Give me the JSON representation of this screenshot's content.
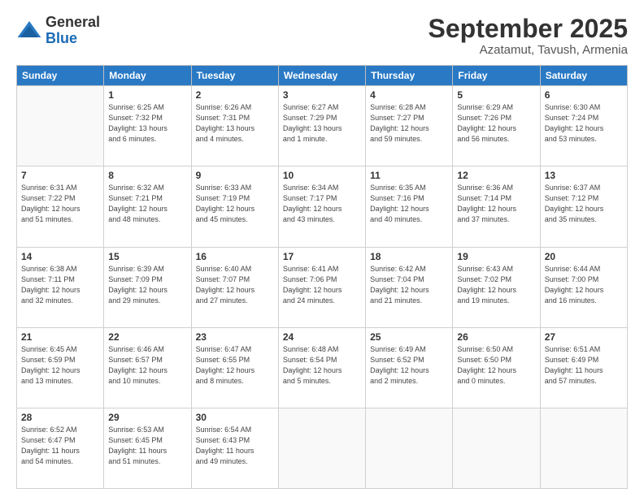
{
  "logo": {
    "general": "General",
    "blue": "Blue"
  },
  "header": {
    "title": "September 2025",
    "subtitle": "Azatamut, Tavush, Armenia"
  },
  "weekdays": [
    "Sunday",
    "Monday",
    "Tuesday",
    "Wednesday",
    "Thursday",
    "Friday",
    "Saturday"
  ],
  "weeks": [
    [
      {
        "day": "",
        "info": ""
      },
      {
        "day": "1",
        "info": "Sunrise: 6:25 AM\nSunset: 7:32 PM\nDaylight: 13 hours\nand 6 minutes."
      },
      {
        "day": "2",
        "info": "Sunrise: 6:26 AM\nSunset: 7:31 PM\nDaylight: 13 hours\nand 4 minutes."
      },
      {
        "day": "3",
        "info": "Sunrise: 6:27 AM\nSunset: 7:29 PM\nDaylight: 13 hours\nand 1 minute."
      },
      {
        "day": "4",
        "info": "Sunrise: 6:28 AM\nSunset: 7:27 PM\nDaylight: 12 hours\nand 59 minutes."
      },
      {
        "day": "5",
        "info": "Sunrise: 6:29 AM\nSunset: 7:26 PM\nDaylight: 12 hours\nand 56 minutes."
      },
      {
        "day": "6",
        "info": "Sunrise: 6:30 AM\nSunset: 7:24 PM\nDaylight: 12 hours\nand 53 minutes."
      }
    ],
    [
      {
        "day": "7",
        "info": "Sunrise: 6:31 AM\nSunset: 7:22 PM\nDaylight: 12 hours\nand 51 minutes."
      },
      {
        "day": "8",
        "info": "Sunrise: 6:32 AM\nSunset: 7:21 PM\nDaylight: 12 hours\nand 48 minutes."
      },
      {
        "day": "9",
        "info": "Sunrise: 6:33 AM\nSunset: 7:19 PM\nDaylight: 12 hours\nand 45 minutes."
      },
      {
        "day": "10",
        "info": "Sunrise: 6:34 AM\nSunset: 7:17 PM\nDaylight: 12 hours\nand 43 minutes."
      },
      {
        "day": "11",
        "info": "Sunrise: 6:35 AM\nSunset: 7:16 PM\nDaylight: 12 hours\nand 40 minutes."
      },
      {
        "day": "12",
        "info": "Sunrise: 6:36 AM\nSunset: 7:14 PM\nDaylight: 12 hours\nand 37 minutes."
      },
      {
        "day": "13",
        "info": "Sunrise: 6:37 AM\nSunset: 7:12 PM\nDaylight: 12 hours\nand 35 minutes."
      }
    ],
    [
      {
        "day": "14",
        "info": "Sunrise: 6:38 AM\nSunset: 7:11 PM\nDaylight: 12 hours\nand 32 minutes."
      },
      {
        "day": "15",
        "info": "Sunrise: 6:39 AM\nSunset: 7:09 PM\nDaylight: 12 hours\nand 29 minutes."
      },
      {
        "day": "16",
        "info": "Sunrise: 6:40 AM\nSunset: 7:07 PM\nDaylight: 12 hours\nand 27 minutes."
      },
      {
        "day": "17",
        "info": "Sunrise: 6:41 AM\nSunset: 7:06 PM\nDaylight: 12 hours\nand 24 minutes."
      },
      {
        "day": "18",
        "info": "Sunrise: 6:42 AM\nSunset: 7:04 PM\nDaylight: 12 hours\nand 21 minutes."
      },
      {
        "day": "19",
        "info": "Sunrise: 6:43 AM\nSunset: 7:02 PM\nDaylight: 12 hours\nand 19 minutes."
      },
      {
        "day": "20",
        "info": "Sunrise: 6:44 AM\nSunset: 7:00 PM\nDaylight: 12 hours\nand 16 minutes."
      }
    ],
    [
      {
        "day": "21",
        "info": "Sunrise: 6:45 AM\nSunset: 6:59 PM\nDaylight: 12 hours\nand 13 minutes."
      },
      {
        "day": "22",
        "info": "Sunrise: 6:46 AM\nSunset: 6:57 PM\nDaylight: 12 hours\nand 10 minutes."
      },
      {
        "day": "23",
        "info": "Sunrise: 6:47 AM\nSunset: 6:55 PM\nDaylight: 12 hours\nand 8 minutes."
      },
      {
        "day": "24",
        "info": "Sunrise: 6:48 AM\nSunset: 6:54 PM\nDaylight: 12 hours\nand 5 minutes."
      },
      {
        "day": "25",
        "info": "Sunrise: 6:49 AM\nSunset: 6:52 PM\nDaylight: 12 hours\nand 2 minutes."
      },
      {
        "day": "26",
        "info": "Sunrise: 6:50 AM\nSunset: 6:50 PM\nDaylight: 12 hours\nand 0 minutes."
      },
      {
        "day": "27",
        "info": "Sunrise: 6:51 AM\nSunset: 6:49 PM\nDaylight: 11 hours\nand 57 minutes."
      }
    ],
    [
      {
        "day": "28",
        "info": "Sunrise: 6:52 AM\nSunset: 6:47 PM\nDaylight: 11 hours\nand 54 minutes."
      },
      {
        "day": "29",
        "info": "Sunrise: 6:53 AM\nSunset: 6:45 PM\nDaylight: 11 hours\nand 51 minutes."
      },
      {
        "day": "30",
        "info": "Sunrise: 6:54 AM\nSunset: 6:43 PM\nDaylight: 11 hours\nand 49 minutes."
      },
      {
        "day": "",
        "info": ""
      },
      {
        "day": "",
        "info": ""
      },
      {
        "day": "",
        "info": ""
      },
      {
        "day": "",
        "info": ""
      }
    ]
  ]
}
